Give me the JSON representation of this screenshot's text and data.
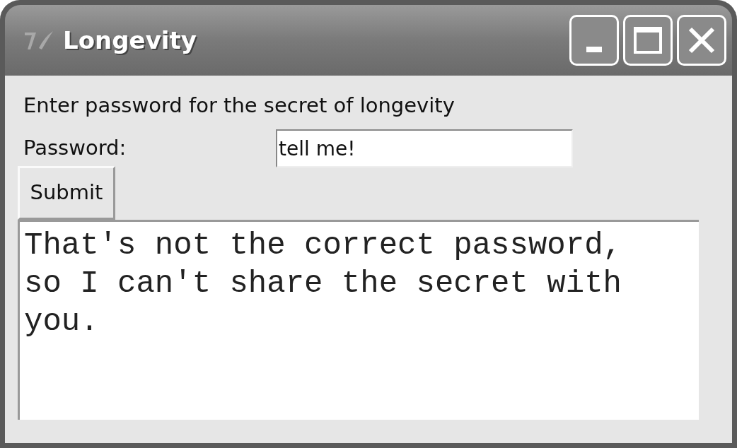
{
  "window": {
    "title": "Longevity"
  },
  "instruction": "Enter password for the secret of longevity",
  "password": {
    "label": "Password:",
    "value": "tell me!"
  },
  "submit_button": "Submit",
  "output": "That's not the correct password, so I can't share the secret with you."
}
